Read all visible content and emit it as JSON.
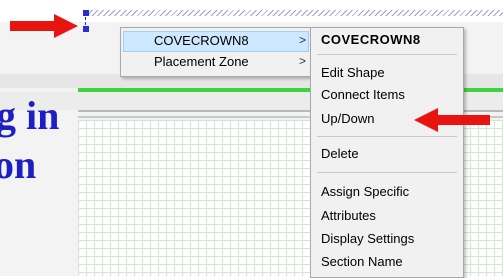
{
  "background": {
    "overlay_text_line1": "g in",
    "overlay_text_line2": "on",
    "overlay_color": "#1d1fc4",
    "centerline_color": "#3fd43f"
  },
  "left_menu": {
    "items": [
      {
        "label": "COVECROWN8",
        "chevron": ">",
        "selected": true
      },
      {
        "label": "Placement Zone",
        "chevron": ">",
        "selected": false
      }
    ]
  },
  "right_menu": {
    "title": "COVECROWN8",
    "items": [
      {
        "label": "Edit Shape"
      },
      {
        "label": "Connect Items"
      },
      {
        "label": "Up/Down"
      },
      {
        "label": "Delete"
      },
      {
        "label": "Assign Specific"
      },
      {
        "label": "Attributes"
      },
      {
        "label": "Display Settings"
      },
      {
        "label": "Section Name"
      }
    ]
  },
  "annotations": {
    "arrow_color": "#e8140f",
    "arrow_top_left_icon": "red-arrow-right-icon",
    "arrow_updown_icon": "red-arrow-left-icon"
  }
}
